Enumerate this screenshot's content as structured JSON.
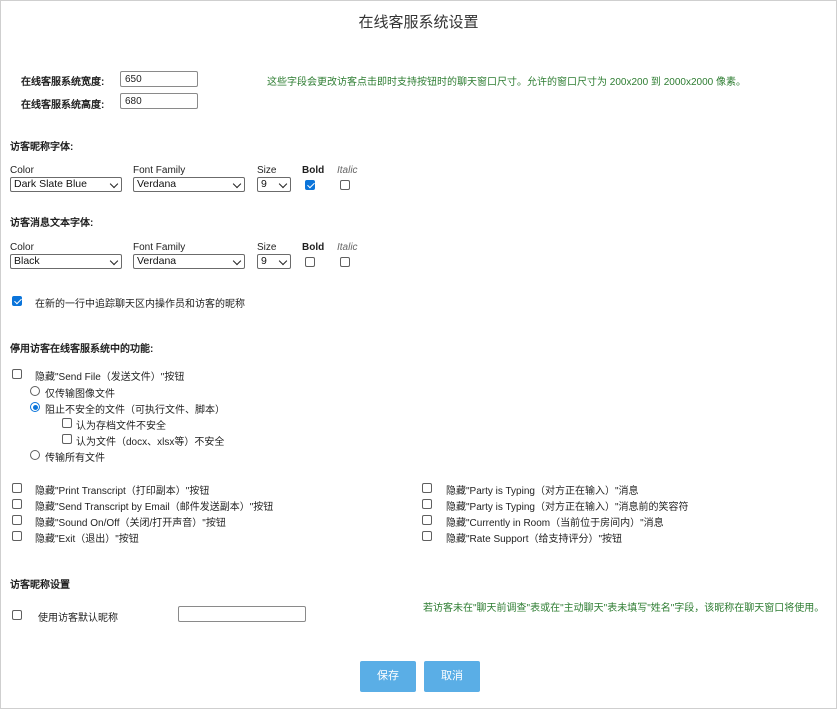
{
  "title": "在线客服系统设置",
  "window_size": {
    "width_label": "在线客服系统宽度:",
    "width_value": "650",
    "height_label": "在线客服系统高度:",
    "height_value": "680",
    "note": "这些字段会更改访客点击即时支持按钮时的聊天窗口尺寸。允许的窗口尺寸为 200x200 到 2000x2000 像素。"
  },
  "font_headers": {
    "color": "Color",
    "family": "Font Family",
    "size": "Size",
    "bold": "Bold",
    "italic": "Italic"
  },
  "nickname_font": {
    "heading": "访客昵称字体:",
    "color": "Dark Slate Blue",
    "family": "Verdana",
    "size": "9",
    "bold": true,
    "italic": false
  },
  "message_font": {
    "heading": "访客消息文本字体:",
    "color": "Black",
    "family": "Verdana",
    "size": "9",
    "bold": false,
    "italic": false
  },
  "newline_option": {
    "label": "在新的一行中追踪聊天区内操作员和访客的昵称",
    "checked": true
  },
  "disable": {
    "heading": "停用访客在线客服系统中的功能:",
    "send_file": {
      "label": "隐藏\"Send File（发送文件）\"按钮",
      "checked": false
    },
    "radios": [
      {
        "label": "仅传输图像文件",
        "checked": false
      },
      {
        "label": "阻止不安全的文件（可执行文件、脚本）",
        "checked": true
      },
      {
        "label": "传输所有文件",
        "checked": false
      }
    ],
    "sub_checks": [
      {
        "label": "认为存档文件不安全",
        "checked": false
      },
      {
        "label": "认为文件（docx、xlsx等）不安全",
        "checked": false
      }
    ],
    "left": [
      {
        "label": "隐藏\"Print Transcript（打印副本）\"按钮",
        "checked": false
      },
      {
        "label": "隐藏\"Send Transcript by Email（邮件发送副本）\"按钮",
        "checked": false
      },
      {
        "label": "隐藏\"Sound On/Off（关闭/打开声音）\"按钮",
        "checked": false
      },
      {
        "label": "隐藏\"Exit（退出）\"按钮",
        "checked": false
      }
    ],
    "right": [
      {
        "label": "隐藏\"Party is Typing（对方正在输入）\"消息",
        "checked": false
      },
      {
        "label": "隐藏\"Party is Typing（对方正在输入）\"消息前的笑容符",
        "checked": false
      },
      {
        "label": "隐藏\"Currently in Room（当前位于房间内）\"消息",
        "checked": false
      },
      {
        "label": "隐藏\"Rate Support（给支持评分）\"按钮",
        "checked": false
      }
    ]
  },
  "nickname_settings": {
    "heading": "访客昵称设置",
    "default_label": "使用访客默认昵称",
    "default_checked": false,
    "default_value": "",
    "note": "若访客未在\"聊天前调查\"表或在\"主动聊天\"表未填写\"姓名\"字段，该昵称在聊天窗口将使用。"
  },
  "buttons": {
    "save": "保存",
    "cancel": "取消"
  },
  "colors": {
    "accent": "#0a74da",
    "button": "#5aaee6",
    "note_green": "#2e7d32"
  }
}
